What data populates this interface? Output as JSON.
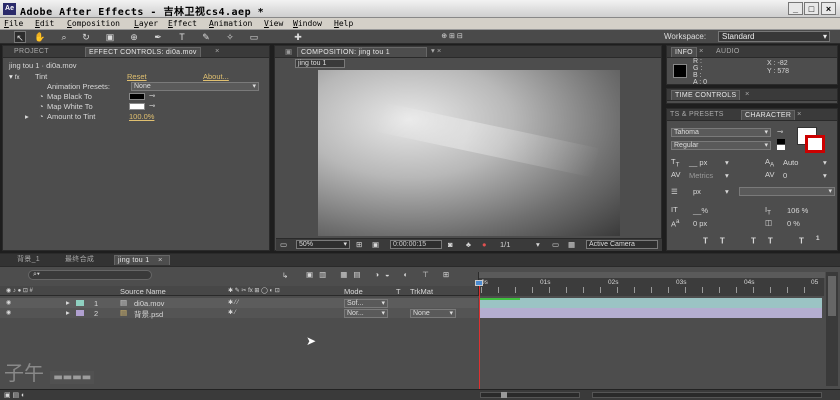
{
  "window": {
    "app_icon": "Ae",
    "title": "Adobe After Effects - 吉林卫视cs4.aep *",
    "controls": [
      "_",
      "□",
      "×"
    ]
  },
  "menu": [
    "File",
    "Edit",
    "Composition",
    "Layer",
    "Effect",
    "Animation",
    "View",
    "Window",
    "Help"
  ],
  "toolbar": {
    "tools": [
      "selection-tool-icon",
      "hand-tool-icon",
      "zoom-tool-icon",
      "rotate-tool-icon",
      "camera-tool-icon",
      "pan-behind-tool-icon",
      "pen-tool-icon",
      "type-tool-icon",
      "brush-tool-icon",
      "clone-tool-icon",
      "eraser-tool-icon",
      "puppet-tool-icon"
    ],
    "tool_glyphs": [
      "↖",
      "✋",
      "🔍",
      "↻",
      "▣",
      "⊕",
      "✒",
      "T",
      "✎",
      "✧",
      "▭",
      "✚"
    ],
    "workspace_label": "Workspace:",
    "workspace_value": "Standard"
  },
  "project_panel": {
    "tabs": [
      "PROJECT",
      "EFFECT CONTROLS: di0a.mov"
    ],
    "breadcrumb": "jing tou 1 · di0a.mov",
    "effect": {
      "name": "Tint",
      "reset": "Reset",
      "about": "About...",
      "preset_label": "Animation Presets:",
      "preset_value": "None",
      "params": [
        {
          "label": "Map Black To"
        },
        {
          "label": "Map White To"
        },
        {
          "label": "Amount to Tint",
          "value": "100.0%"
        }
      ],
      "black_color": "#000000",
      "white_color": "#ffffff"
    }
  },
  "comp_panel": {
    "tab": "COMPOSITION: jing tou 1",
    "subtab": "jing tou 1",
    "controls": {
      "zoom": "50%",
      "timecode": "0:00:00:15",
      "resolution": "1/1",
      "camera": "Active Camera"
    }
  },
  "info_panel": {
    "tabs": [
      "INFO",
      "AUDIO"
    ],
    "rgb": [
      "R :",
      "G :",
      "B :",
      "A : 0"
    ],
    "x": "X : -82",
    "y": "Y : 578"
  },
  "time_controls": {
    "tab": "TIME CONTROLS"
  },
  "character_panel": {
    "tabs": [
      "TS & PRESETS",
      "CHARACTER"
    ],
    "font": "Tahoma",
    "style": "Regular",
    "size": "__ px",
    "leading": "Auto",
    "kerning": "Metrics",
    "tracking": "0",
    "stroke_width": "px",
    "vert_scale": "__%",
    "horiz_scale": "106 %",
    "baseline": "0 px",
    "tsume": "0 %"
  },
  "timeline": {
    "tabs": [
      "背景_1",
      "最终合成",
      "jing tou 1"
    ],
    "search_placeholder": "",
    "columns": {
      "source_name": "Source Name",
      "mode": "Mode",
      "t": "T",
      "trkmat": "TrkMat"
    },
    "ruler": [
      "0s",
      "01s",
      "02s",
      "03s",
      "04s",
      "05"
    ],
    "layers": [
      {
        "num": "1",
        "name": "di0a.mov",
        "mode": "Sof...",
        "trkmat": "",
        "color": "#8fd0c0",
        "bar_color": "#9bc4c4"
      },
      {
        "num": "2",
        "name": "背景.psd",
        "mode": "Nor...",
        "trkmat": "None",
        "color": "#b0a0d0",
        "bar_color": "#b4aed0"
      }
    ]
  },
  "watermark": "子午"
}
